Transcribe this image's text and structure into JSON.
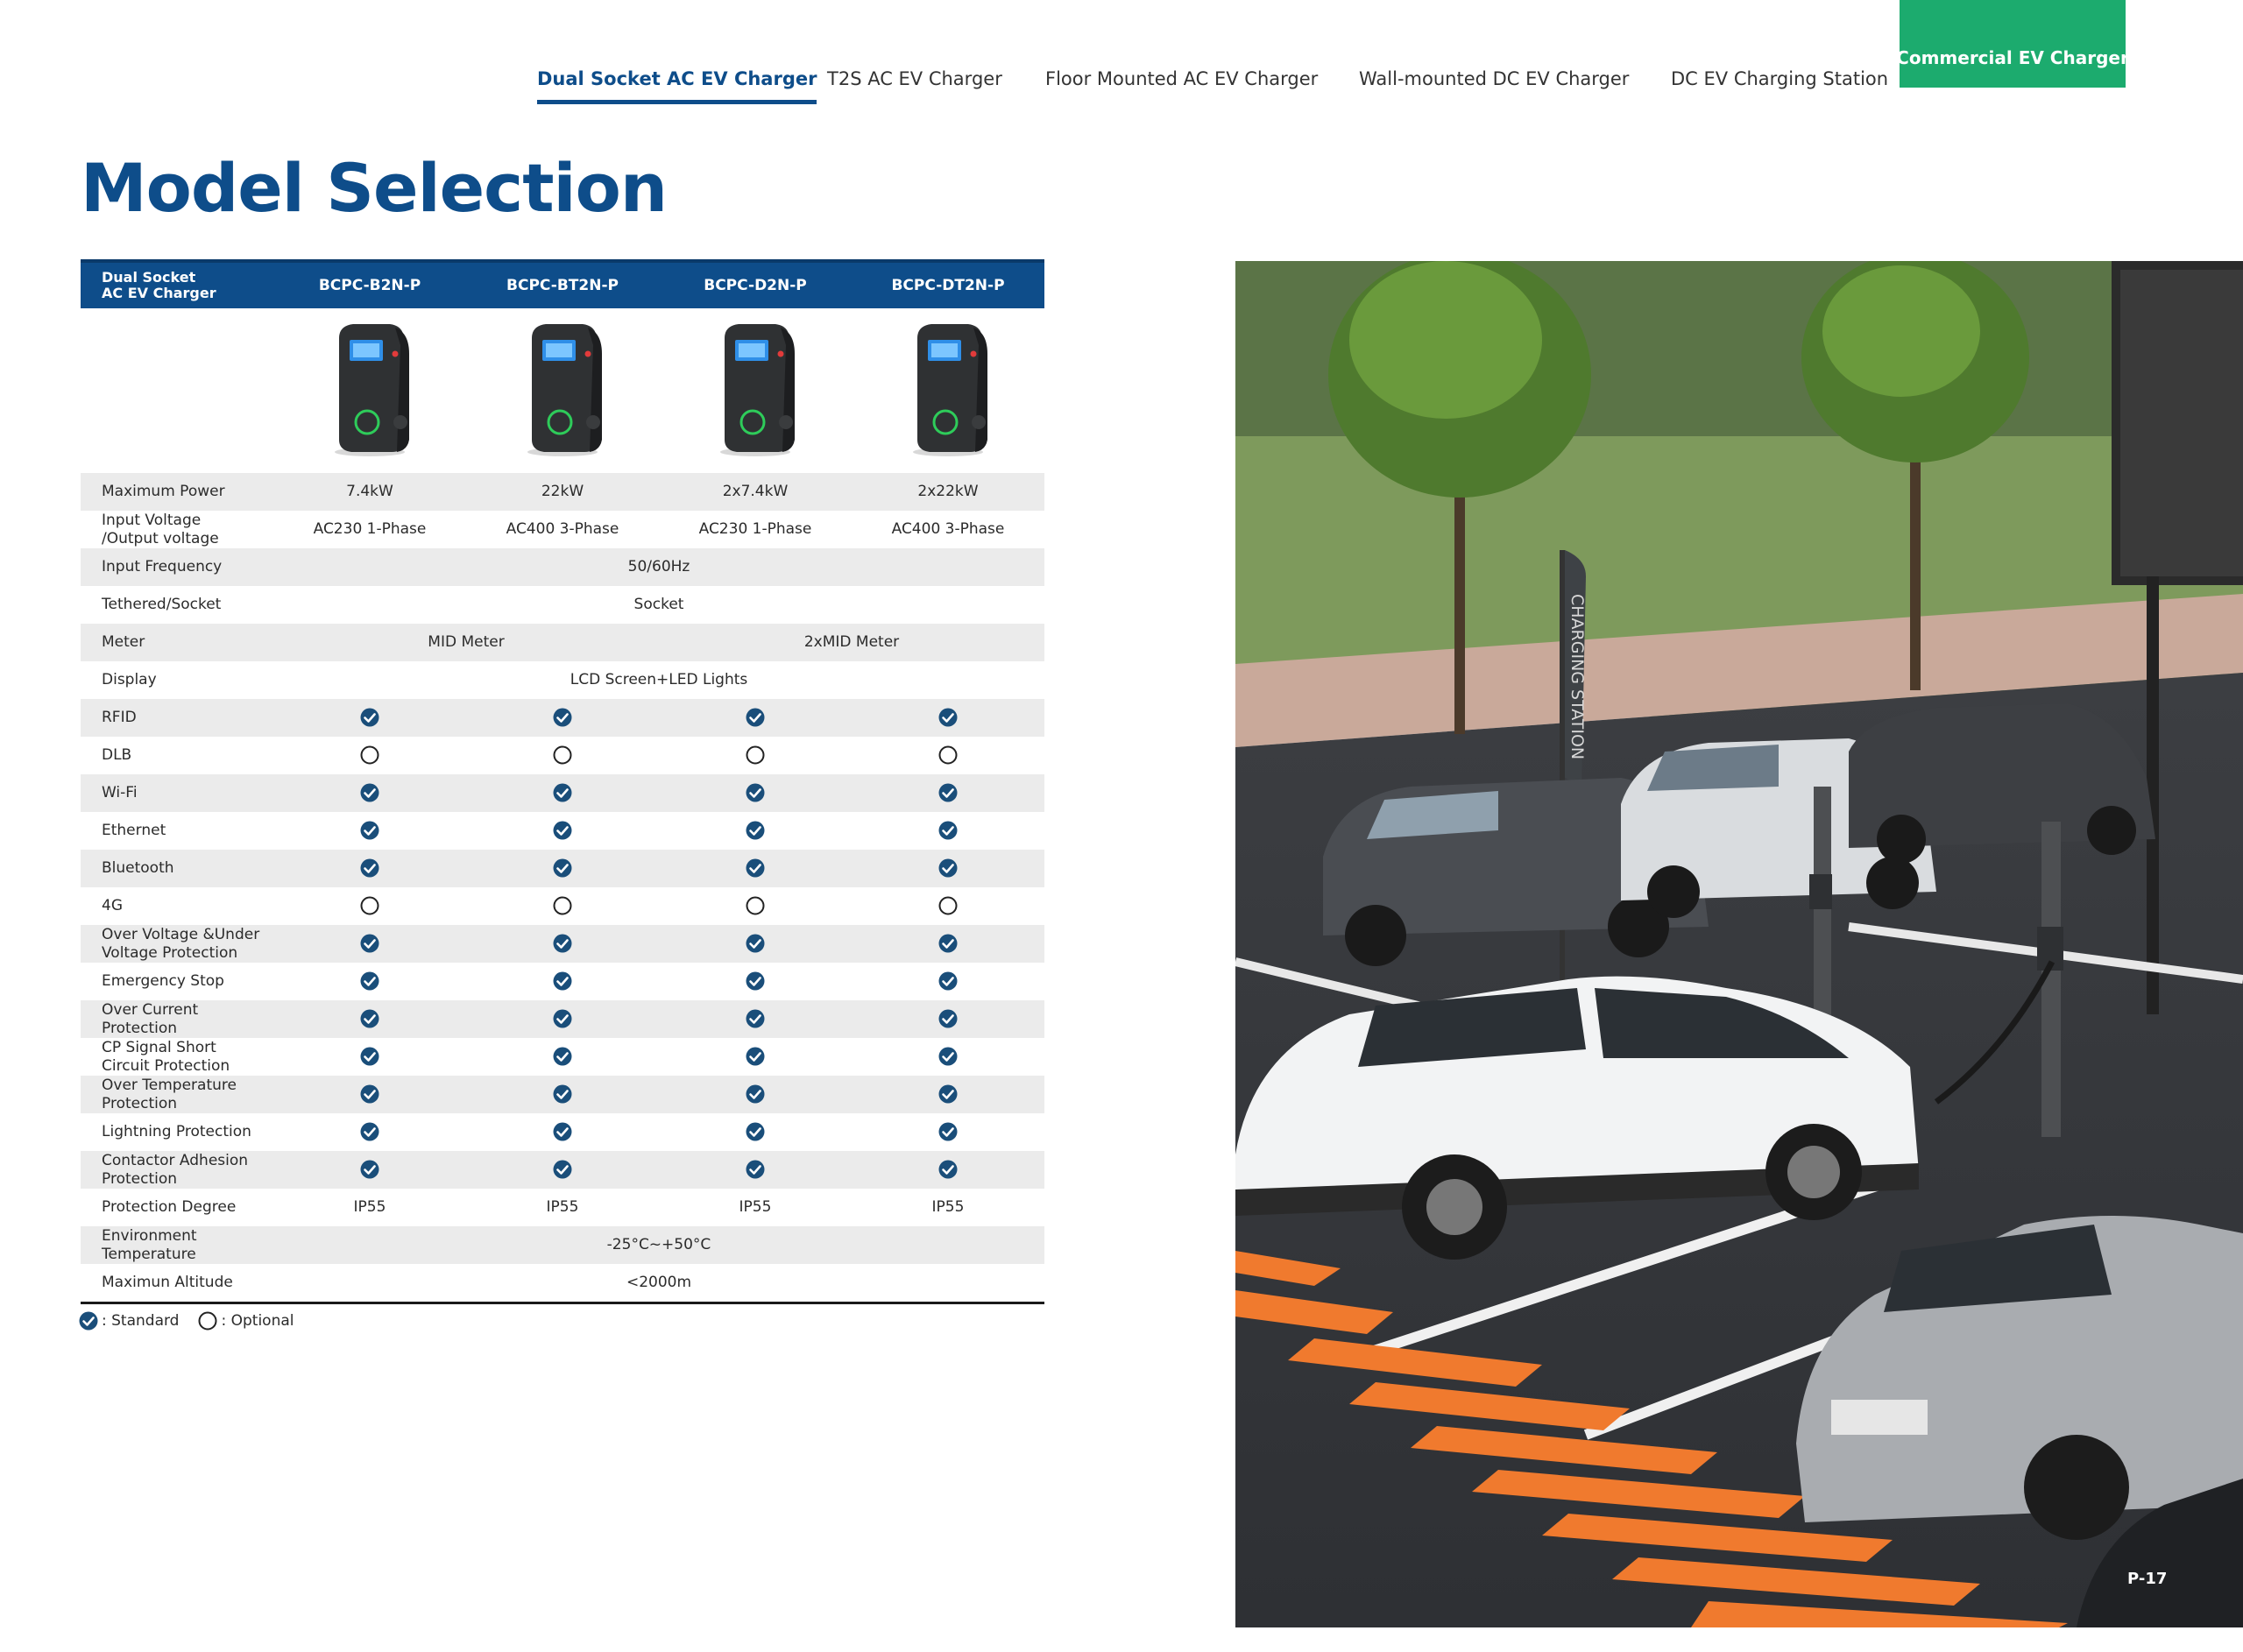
{
  "nav": {
    "tabs": [
      {
        "label": "Dual Socket AC EV Charger",
        "active": true
      },
      {
        "label": "T2S AC EV Charger",
        "active": false
      },
      {
        "label": "Floor Mounted AC EV Charger",
        "active": false
      },
      {
        "label": "Wall-mounted DC EV Charger",
        "active": false
      },
      {
        "label": "DC EV Charging Station",
        "active": false
      }
    ],
    "brand_tab": "Commercial EV Charger"
  },
  "title": "Model Selection",
  "table": {
    "corner_label_1": "Dual Socket",
    "corner_label_2": "AC EV Charger",
    "models": [
      "BCPC-B2N-P",
      "BCPC-BT2N-P",
      "BCPC-D2N-P",
      "BCPC-DT2N-P"
    ],
    "rows": [
      {
        "label": "Maximum Power",
        "cells": [
          {
            "text": "7.4kW",
            "span": 1
          },
          {
            "text": "22kW",
            "span": 1
          },
          {
            "text": "2x7.4kW",
            "span": 1
          },
          {
            "text": "2x22kW",
            "span": 1
          }
        ]
      },
      {
        "label": "Input Voltage\n/Output voltage",
        "cells": [
          {
            "text": "AC230 1-Phase",
            "span": 1
          },
          {
            "text": "AC400 3-Phase",
            "span": 1
          },
          {
            "text": "AC230 1-Phase",
            "span": 1
          },
          {
            "text": "AC400 3-Phase",
            "span": 1
          }
        ]
      },
      {
        "label": "Input Frequency",
        "cells": [
          {
            "text": "50/60Hz",
            "span": 4
          }
        ]
      },
      {
        "label": "Tethered/Socket",
        "cells": [
          {
            "text": "Socket",
            "span": 4
          }
        ]
      },
      {
        "label": "Meter",
        "cells": [
          {
            "text": "MID Meter",
            "span": 2
          },
          {
            "text": "2xMID Meter",
            "span": 2
          }
        ]
      },
      {
        "label": "Display",
        "cells": [
          {
            "text": "LCD Screen+LED Lights",
            "span": 4
          }
        ]
      },
      {
        "label": "RFID",
        "marks": [
          "standard",
          "standard",
          "standard",
          "standard"
        ]
      },
      {
        "label": "DLB",
        "marks": [
          "optional",
          "optional",
          "optional",
          "optional"
        ]
      },
      {
        "label": "Wi-Fi",
        "marks": [
          "standard",
          "standard",
          "standard",
          "standard"
        ]
      },
      {
        "label": "Ethernet",
        "marks": [
          "standard",
          "standard",
          "standard",
          "standard"
        ]
      },
      {
        "label": "Bluetooth",
        "marks": [
          "standard",
          "standard",
          "standard",
          "standard"
        ]
      },
      {
        "label": "4G",
        "marks": [
          "optional",
          "optional",
          "optional",
          "optional"
        ]
      },
      {
        "label": "Over Voltage &Under\nVoltage Protection",
        "marks": [
          "standard",
          "standard",
          "standard",
          "standard"
        ]
      },
      {
        "label": "Emergency Stop",
        "marks": [
          "standard",
          "standard",
          "standard",
          "standard"
        ]
      },
      {
        "label": "Over Current\nProtection",
        "marks": [
          "standard",
          "standard",
          "standard",
          "standard"
        ]
      },
      {
        "label": "CP Signal Short\nCircuit Protection",
        "marks": [
          "standard",
          "standard",
          "standard",
          "standard"
        ]
      },
      {
        "label": "Over Temperature\nProtection",
        "marks": [
          "standard",
          "standard",
          "standard",
          "standard"
        ]
      },
      {
        "label": "Lightning Protection",
        "marks": [
          "standard",
          "standard",
          "standard",
          "standard"
        ]
      },
      {
        "label": "Contactor Adhesion\nProtection",
        "marks": [
          "standard",
          "standard",
          "standard",
          "standard"
        ]
      },
      {
        "label": "Protection Degree",
        "cells": [
          {
            "text": "IP55",
            "span": 1
          },
          {
            "text": "IP55",
            "span": 1
          },
          {
            "text": "IP55",
            "span": 1
          },
          {
            "text": "IP55",
            "span": 1
          }
        ]
      },
      {
        "label": "Environment\nTemperature",
        "cells": [
          {
            "text": "-25°C~+50°C",
            "span": 4
          }
        ]
      },
      {
        "label": "Maximun Altitude",
        "cells": [
          {
            "text": "<2000m",
            "span": 4
          }
        ]
      }
    ]
  },
  "legend": {
    "standard_label": ": Standard",
    "optional_label": ": Optional"
  },
  "photo": {
    "flag_text": "CHARGING STATION",
    "page_number": "P-17"
  },
  "colors": {
    "brand_blue": "#0e4d8a",
    "brand_green": "#1cab6e",
    "check_fill": "#1a4e7a"
  }
}
